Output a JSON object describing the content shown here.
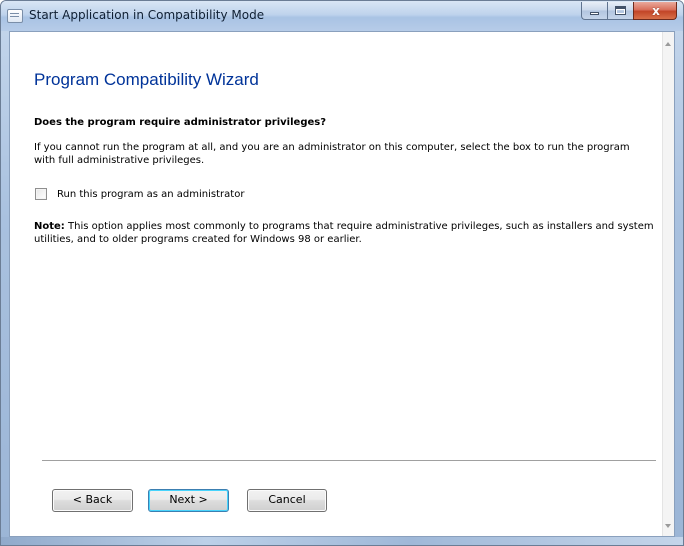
{
  "window": {
    "title": "Start Application in Compatibility Mode",
    "close_glyph": "x"
  },
  "wizard": {
    "title": "Program Compatibility Wizard",
    "question": "Does the program require administrator privileges?",
    "description": "If you cannot run the program at all, and you are an administrator on this computer, select the box to run the program with full administrative privileges.",
    "checkbox": {
      "label": "Run this program as an administrator",
      "checked": false
    },
    "note_prefix": "Note:",
    "note_text": " This option applies most commonly to programs that require administrative privileges, such as installers and system utilities, and to older programs created for Windows 98 or earlier."
  },
  "buttons": {
    "back": "< Back",
    "next": "Next >",
    "cancel": "Cancel"
  },
  "icons": {
    "app": "window-app-icon",
    "minimize": "minimize-icon",
    "maximize": "maximize-icon",
    "close": "close-icon",
    "scroll_up": "scroll-up-arrow-icon",
    "scroll_down": "scroll-down-arrow-icon"
  },
  "colors": {
    "title_accent": "#003399",
    "close_button": "#c24527"
  }
}
